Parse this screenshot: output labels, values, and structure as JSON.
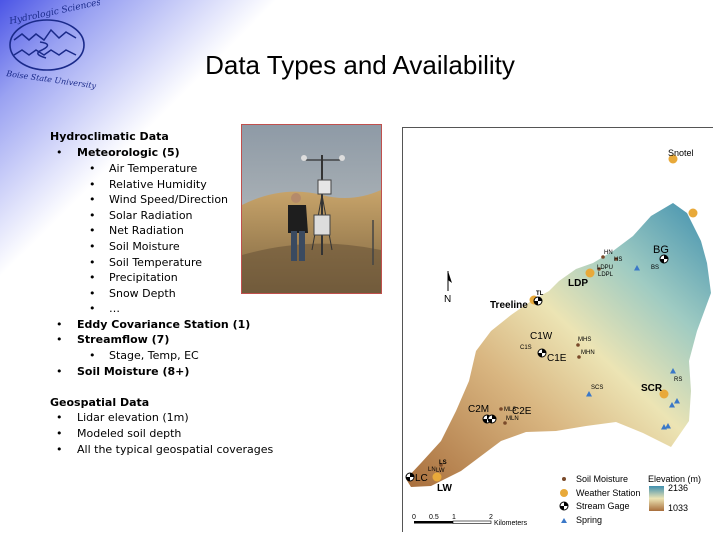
{
  "logo": {
    "text_top": "Hydrologic Sciences",
    "text_bottom": "Boise State University"
  },
  "title": "Data Types and Availability",
  "hydroclimatic": {
    "heading": "Hydroclimatic Data",
    "bullet": "•",
    "meteorologic": "Meteorologic (5)",
    "met_items": [
      "Air Temperature",
      "Relative Humidity",
      "Wind Speed/Direction",
      "Solar Radiation",
      "Net Radiation",
      "Soil Moisture",
      "Soil Temperature",
      "Precipitation",
      "Snow Depth",
      "…"
    ],
    "eddy": "Eddy Covariance Station (1)",
    "streamflow": "Streamflow (7)",
    "stream_items": [
      "Stage, Temp, EC"
    ],
    "soil": "Soil Moisture (8+)"
  },
  "geospatial": {
    "heading": "Geospatial Data",
    "items": [
      "Lidar elevation (1m)",
      "Modeled soil depth",
      "All the typical geospatial coverages"
    ]
  },
  "map": {
    "labels": {
      "snotel": "Snotel",
      "bg": "BG",
      "bs": "BS",
      "hn": "HN",
      "hs": "HS",
      "ldpu": "LDPU",
      "ldpl": "LDPL",
      "ldp": "LDP",
      "tl": "TL",
      "treeline": "Treeline",
      "c1w": "C1W",
      "c1s": "C1S",
      "c1e": "C1E",
      "mhs": "MHS",
      "mhn": "MHN",
      "scs": "SCS",
      "scr": "SCR",
      "rs": "RS",
      "c2m": "C2M",
      "c2e": "C2E",
      "mls": "MLS",
      "mln": "MLN",
      "lc": "LC",
      "lw": "LW",
      "ls": "LS",
      "ln": "LN",
      "lw_small": "LW",
      "north": "N"
    },
    "legend": {
      "soil_moisture": "Soil Moisture",
      "weather_station": "Weather Station",
      "stream_gage": "Stream Gage",
      "spring": "Spring",
      "elevation_title": "Elevation (m)",
      "elev_max": "2136",
      "elev_min": "1033"
    },
    "scale": {
      "t0": "0",
      "t1": "0.5",
      "t2": "1",
      "t3": "2",
      "unit": "Kilometers"
    },
    "colors": {
      "weather": "#e8a93a",
      "soil": "#7a4a2a",
      "spring": "#3a78c8",
      "elev_high": "#3f8fae",
      "elev_mid": "#ece4b4",
      "elev_low": "#a86e3c"
    }
  }
}
